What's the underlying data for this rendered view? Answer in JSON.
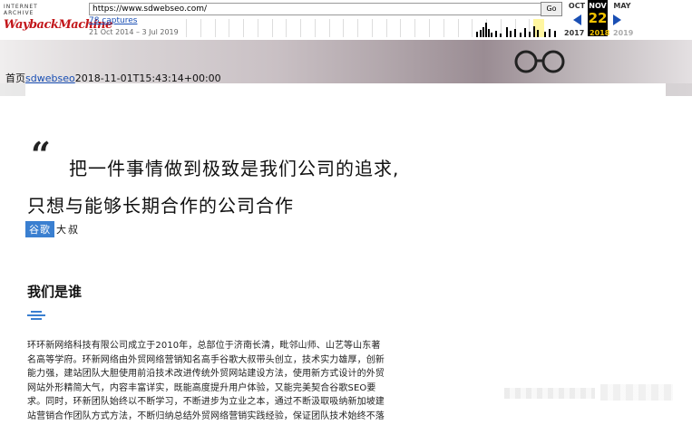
{
  "wayback": {
    "logo_top": "INTERNET ARCHIVE",
    "logo_main": "WaybackMachine",
    "url": "https://www.sdwebseo.com/",
    "go_label": "Go",
    "captures": "78 captures",
    "range": "21 Oct 2014 – 3 Jul 2019",
    "months": {
      "prev": "OCT",
      "current": "NOV",
      "next": "MAY"
    },
    "day": "22",
    "years": {
      "prev": "2017",
      "current": "2018",
      "next": "2019"
    },
    "accent": "#c2161a",
    "highlight": "#f2c200"
  },
  "header": {
    "home": "首页",
    "site": "sdwebseo",
    "timestamp": "2018-11-01T15:43:14+00:00"
  },
  "article": {
    "quote_mark": "“",
    "slogan_line1": "把一件事情做到极致是我们公司的追求,",
    "slogan_line2": "只想与能够长期合作的公司合作",
    "author_tag": "谷歌",
    "author_name": "大叔",
    "section_title": "我们是谁",
    "paragraph_lines": [
      "环环新网络科技有限公司成立于2010年，总部位于济南长清，毗邻山师、山艺等山东著",
      "名高等学府。环新网络由外贸网络营销知名高手谷歌大叔带头创立，技术实力雄厚，创新",
      "能力强，建站团队大胆使用前沿技术改进传统外贸网站建设方法，使用新方式设计的外贸",
      "网站外形精简大气，内容丰富详实，既能高度提升用户体验，又能完美契合谷歌SEO要",
      "求。同时，环新团队始终以不断学习，不断进步为立业之本，通过不断汲取吸纳新加坡建",
      "站营销合作团队方式方法，不断归纳总结外贸网络营销实践经验，保证团队技术始终不落"
    ]
  }
}
